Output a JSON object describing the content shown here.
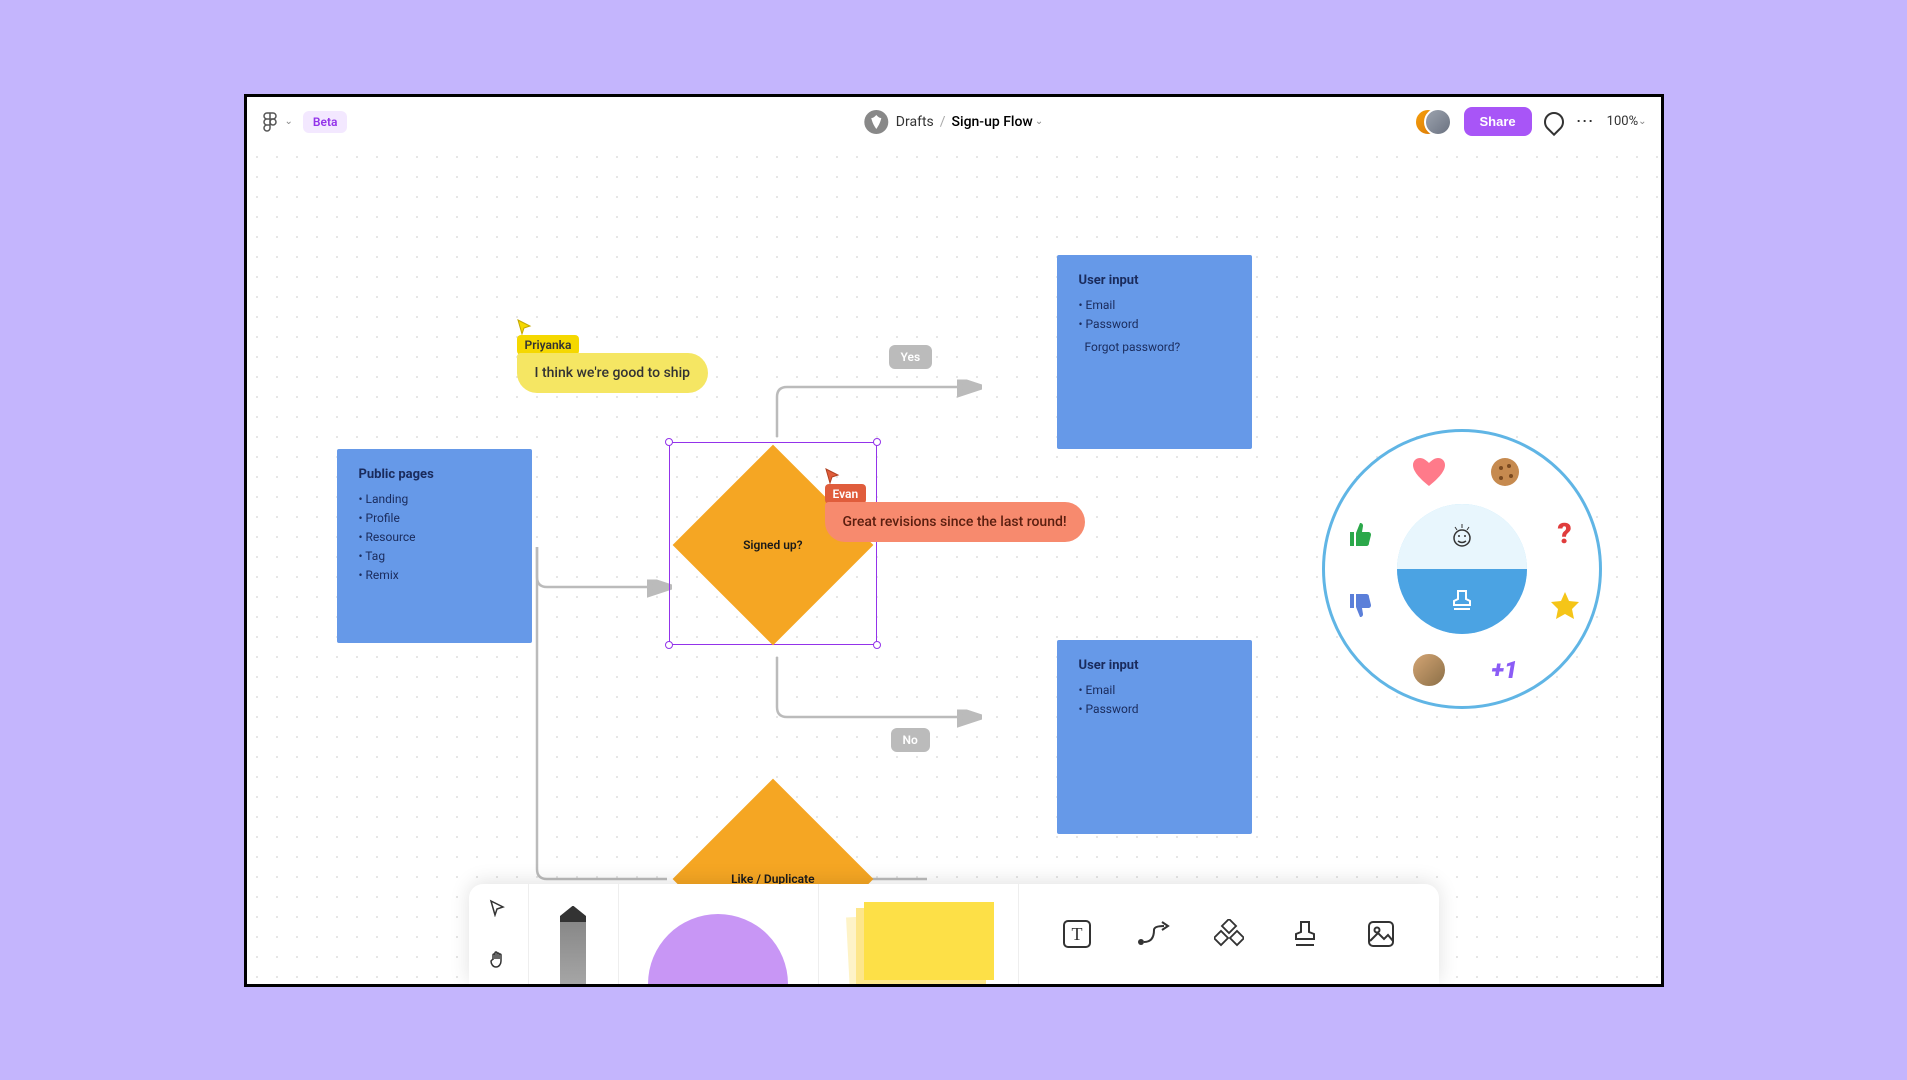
{
  "topbar": {
    "beta_label": "Beta",
    "breadcrumb_parent": "Drafts",
    "breadcrumb_title": "Sign-up Flow",
    "share_label": "Share",
    "zoom": "100%"
  },
  "canvas": {
    "public_pages": {
      "title": "Public pages",
      "items": [
        "Landing",
        "Profile",
        "Resource",
        "Tag",
        "Remix"
      ]
    },
    "signed_up": {
      "label": "Signed up?"
    },
    "like_dup": {
      "label": "Like / Duplicate"
    },
    "user_input_top": {
      "title": "User input",
      "items": [
        "Email",
        "Password"
      ],
      "extra": "Forgot password?"
    },
    "user_input_bottom": {
      "title": "User input",
      "items": [
        "Email",
        "Password"
      ]
    },
    "edge_yes": "Yes",
    "edge_no": "No",
    "cursors": {
      "priyanka": {
        "name": "Priyanka",
        "message": "I think we're good to ship"
      },
      "evan": {
        "name": "Evan",
        "message": "Great revisions since the last round!"
      }
    }
  },
  "wheel": {
    "items": [
      "heart",
      "cookie",
      "thumbs-up",
      "question",
      "thumbs-down",
      "star",
      "avatar",
      "plus-one"
    ]
  },
  "toolbar": {
    "tools": [
      "text",
      "connector",
      "widgets",
      "stamp",
      "image"
    ]
  },
  "colors": {
    "accent": "#A855F7",
    "node_blue": "#6699E8",
    "node_orange": "#F5A623",
    "cursor_yellow": "#F5D800",
    "cursor_red": "#E05D3C"
  }
}
